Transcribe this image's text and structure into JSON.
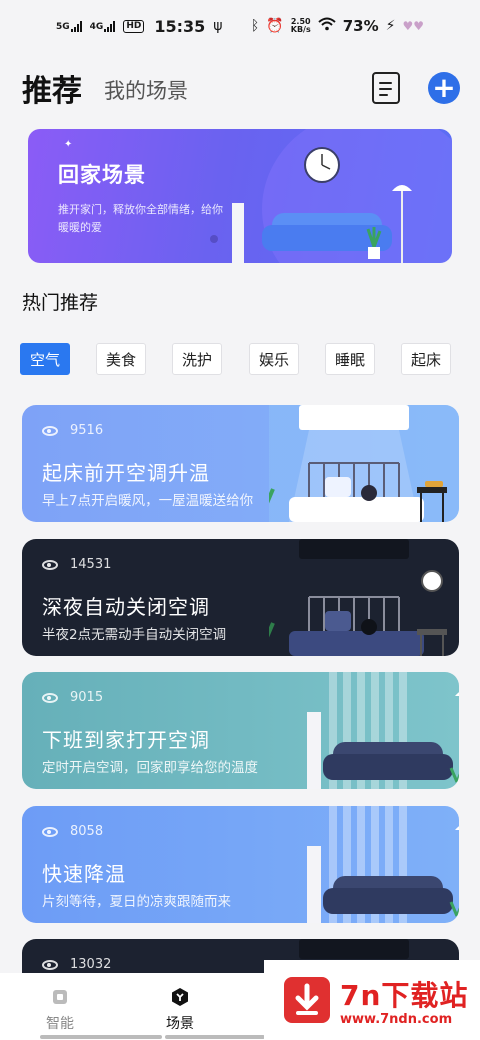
{
  "status_bar": {
    "signal_1": "5G",
    "signal_2": "4G",
    "hd": "HD",
    "time": "15:35",
    "net_speed_value": "2.50",
    "net_speed_unit": "KB/s",
    "battery": "73%"
  },
  "header": {
    "tab_active": "推荐",
    "tab_inactive": "我的场景"
  },
  "banner": {
    "title": "回家场景",
    "subtitle": "推开家门，释放你全部情绪，给你暖暖的爱"
  },
  "section_title": "热门推荐",
  "chips": [
    {
      "label": "空气",
      "active": true
    },
    {
      "label": "美食",
      "active": false
    },
    {
      "label": "洗护",
      "active": false
    },
    {
      "label": "娱乐",
      "active": false
    },
    {
      "label": "睡眠",
      "active": false
    },
    {
      "label": "起床",
      "active": false
    }
  ],
  "cards": [
    {
      "views": "9516",
      "title": "起床前开空调升温",
      "subtitle": "早上7点开启暖风，一屋温暖送给你",
      "theme": "#7fa8f7"
    },
    {
      "views": "14531",
      "title": "深夜自动关闭空调",
      "subtitle": "半夜2点无需动手自动关闭空调",
      "theme": "#1c2230"
    },
    {
      "views": "9015",
      "title": "下班到家打开空调",
      "subtitle": "定时开启空调，回家即享给您的温度",
      "theme": "#6cb3bd"
    },
    {
      "views": "8058",
      "title": "快速降温",
      "subtitle": "片刻等待，夏日的凉爽跟随而来",
      "theme": "#6f9ff6"
    },
    {
      "views": "13032",
      "title": "",
      "subtitle": "",
      "theme": "#1c2230"
    }
  ],
  "bottom_nav": {
    "item_smart": "智能",
    "item_scene": "场景"
  },
  "watermark": {
    "title": "7n下载站",
    "url": "www.7ndn.com"
  },
  "colors": {
    "accent": "#2a78f0",
    "add_button": "#2e6fe8",
    "banner_start": "#8b5cf6",
    "banner_end": "#5a6ef5"
  }
}
